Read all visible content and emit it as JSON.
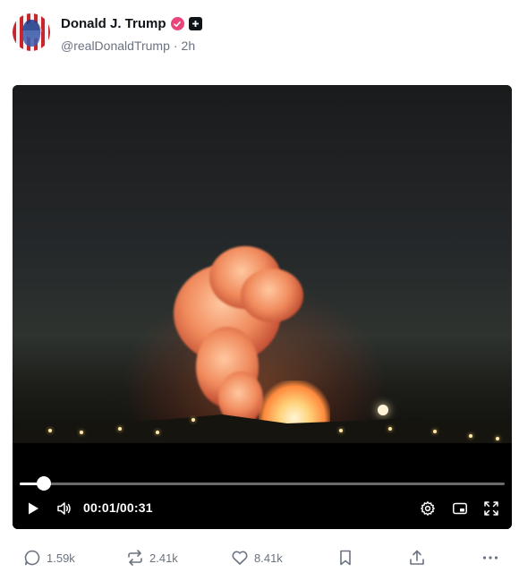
{
  "post": {
    "author": {
      "display_name": "Donald J. Trump",
      "handle": "@realDonaldTrump",
      "separator": "·",
      "timestamp": "2h",
      "verified_icon": "verified-badge-icon",
      "plus_icon": "plus-badge-icon"
    },
    "video": {
      "current_time": "00:01",
      "duration": "00:31",
      "time_separator": "/",
      "progress_fraction": 0.05,
      "icons": [
        "play-icon",
        "volume-icon",
        "settings-icon",
        "picture-in-picture-icon",
        "fullscreen-icon"
      ]
    },
    "actions": {
      "replies": "1.59k",
      "reposts": "2.41k",
      "likes": "8.41k"
    }
  },
  "colors": {
    "verified": "#e8457a",
    "text_primary": "#0f1419",
    "text_secondary": "#6b7280",
    "video_background": "#000000"
  }
}
